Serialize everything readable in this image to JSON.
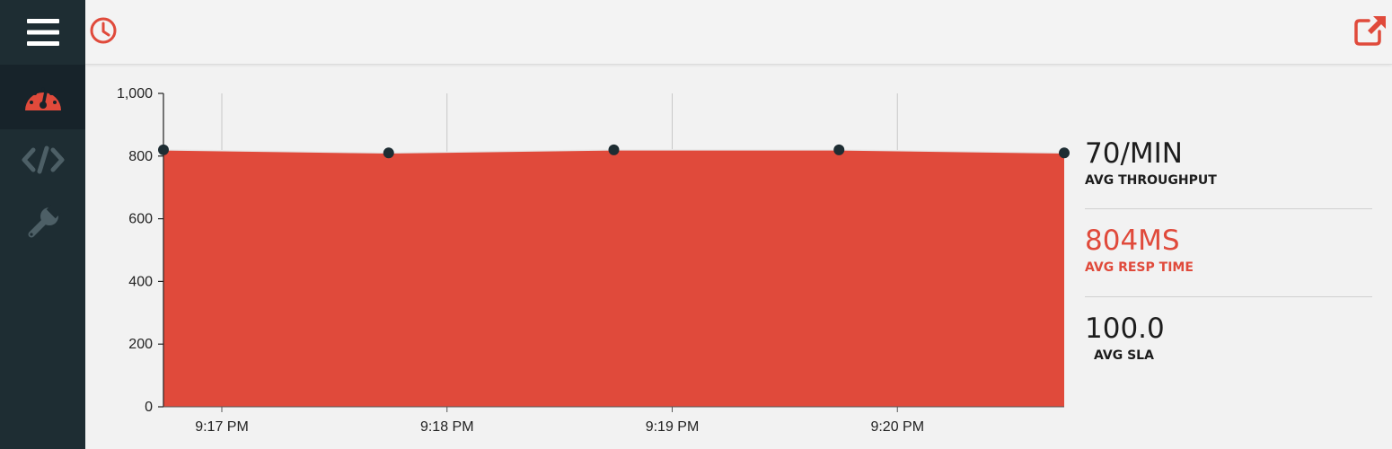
{
  "sidebar": {
    "menu_icon": "hamburger-menu-icon",
    "items": [
      {
        "icon": "dashboard-gauge-icon",
        "active": true
      },
      {
        "icon": "code-icon",
        "active": false
      },
      {
        "icon": "wrench-icon",
        "active": false
      }
    ]
  },
  "topbar": {
    "left_icon": "clock-icon",
    "right_icon": "external-link-icon"
  },
  "colors": {
    "accent": "#e04a3b",
    "sidebar_bg": "#1e2d33",
    "sidebar_active_bg": "#17232a",
    "sidebar_icon_inactive": "#4d5f66",
    "point": "#1e2d33"
  },
  "chart_data": {
    "type": "area",
    "x": [
      "9:16:40 PM",
      "9:17:40 PM",
      "9:18:40 PM",
      "9:19:40 PM",
      "9:20:40 PM"
    ],
    "values": [
      820,
      810,
      820,
      820,
      810
    ],
    "y_ticks": [
      "0",
      "200",
      "400",
      "600",
      "800",
      "1,000"
    ],
    "x_tick_labels": [
      "9:17 PM",
      "9:18 PM",
      "9:19 PM",
      "9:20 PM",
      "9:20"
    ],
    "ylim": [
      0,
      1000
    ],
    "grid": "vertical"
  },
  "stats": {
    "throughput": {
      "value": "70/MIN",
      "label": "AVG THROUGHPUT"
    },
    "resp_time": {
      "value": "804MS",
      "label": "AVG RESP TIME"
    },
    "sla": {
      "value": "100.0",
      "label": "AVG SLA"
    }
  }
}
